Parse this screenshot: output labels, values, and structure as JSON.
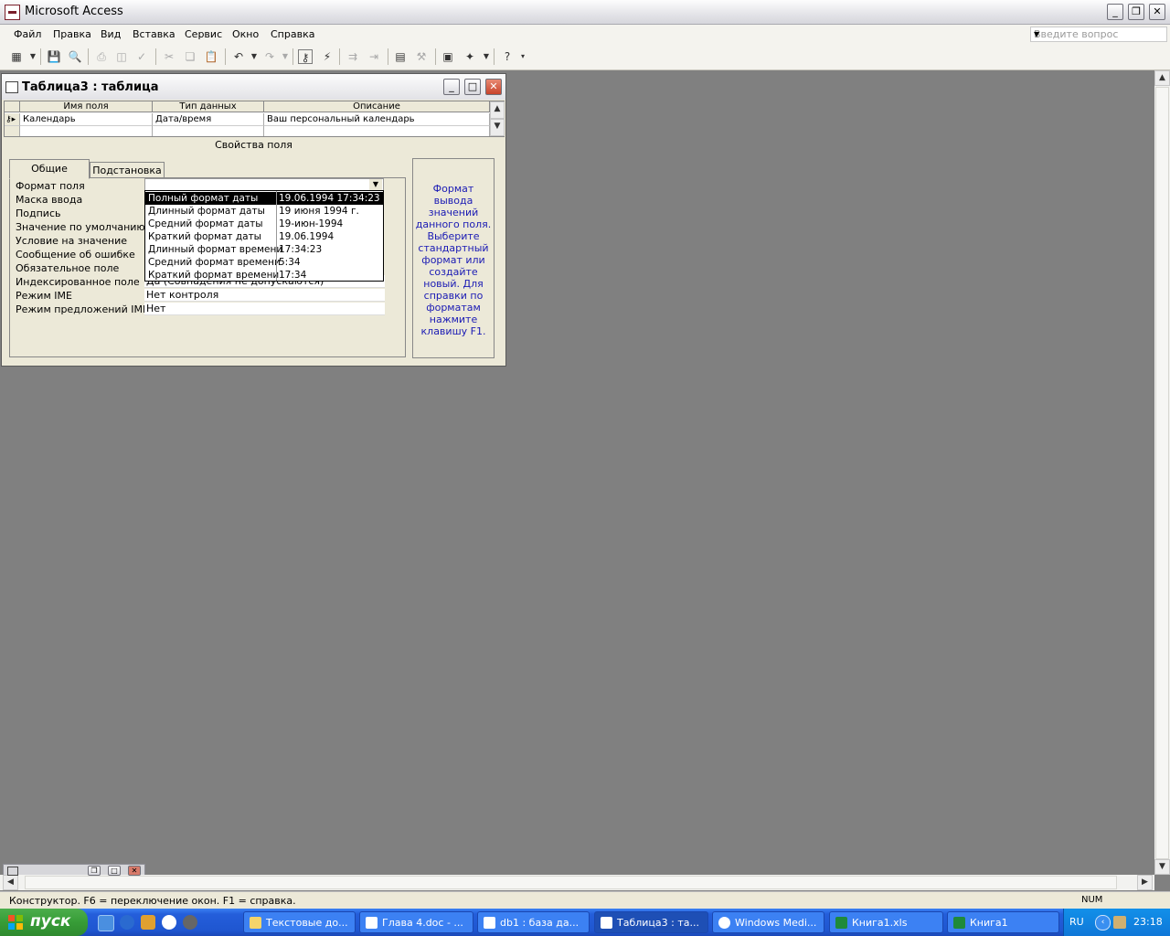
{
  "app": {
    "title": "Microsoft Access"
  },
  "menubar": {
    "items": [
      "Файл",
      "Правка",
      "Вид",
      "Вставка",
      "Сервис",
      "Окно",
      "Справка"
    ],
    "question_placeholder": "Введите вопрос"
  },
  "table_window": {
    "title": "Таблица3 : таблица",
    "columns": [
      "Имя поля",
      "Тип данных",
      "Описание"
    ],
    "row": {
      "field": "Календарь",
      "type": "Дата/время",
      "description": "Ваш персональный календарь"
    },
    "properties_label": "Свойства поля",
    "tabs": [
      "Общие",
      "Подстановка"
    ],
    "properties": [
      {
        "label": "Формат поля",
        "value": ""
      },
      {
        "label": "Маска ввода",
        "value": ""
      },
      {
        "label": "Подпись",
        "value": ""
      },
      {
        "label": "Значение по умолчанию",
        "value": ""
      },
      {
        "label": "Условие на значение",
        "value": ""
      },
      {
        "label": "Сообщение об ошибке",
        "value": ""
      },
      {
        "label": "Обязательное поле",
        "value": ""
      },
      {
        "label": "Индексированное поле",
        "value": "Да (Совпадения не допускаются)"
      },
      {
        "label": "Режим IME",
        "value": "Нет контроля"
      },
      {
        "label": "Режим предложений IME",
        "value": "Нет"
      }
    ],
    "format_options": [
      {
        "name": "Полный формат даты",
        "example": "19.06.1994 17:34:23"
      },
      {
        "name": "Длинный формат даты",
        "example": "19 июня 1994 г."
      },
      {
        "name": "Средний формат даты",
        "example": "19-июн-1994"
      },
      {
        "name": "Краткий формат даты",
        "example": "19.06.1994"
      },
      {
        "name": "Длинный формат времени",
        "example": "17:34:23"
      },
      {
        "name": "Средний формат времени",
        "example": "5:34"
      },
      {
        "name": "Краткий формат времени",
        "example": "17:34"
      }
    ],
    "selected_option_index": 0,
    "help_text": "Формат вывода значений данного поля. Выберите стандартный формат или создайте новый.  Для справки по форматам нажмите клавишу F1."
  },
  "statusbar": {
    "text": "Конструктор.  F6 = переключение окон.  F1 = справка.",
    "indicator": "NUM"
  },
  "taskbar": {
    "start": "пуск",
    "tasks": [
      "Текстовые до...",
      "Глава 4.doc - ...",
      "db1 : база да...",
      "Таблица3 : та...",
      "Windows Medi...",
      "Книга1.xls",
      "Книга1"
    ],
    "active_task_index": 3,
    "lang": "RU",
    "clock": "23:18"
  }
}
